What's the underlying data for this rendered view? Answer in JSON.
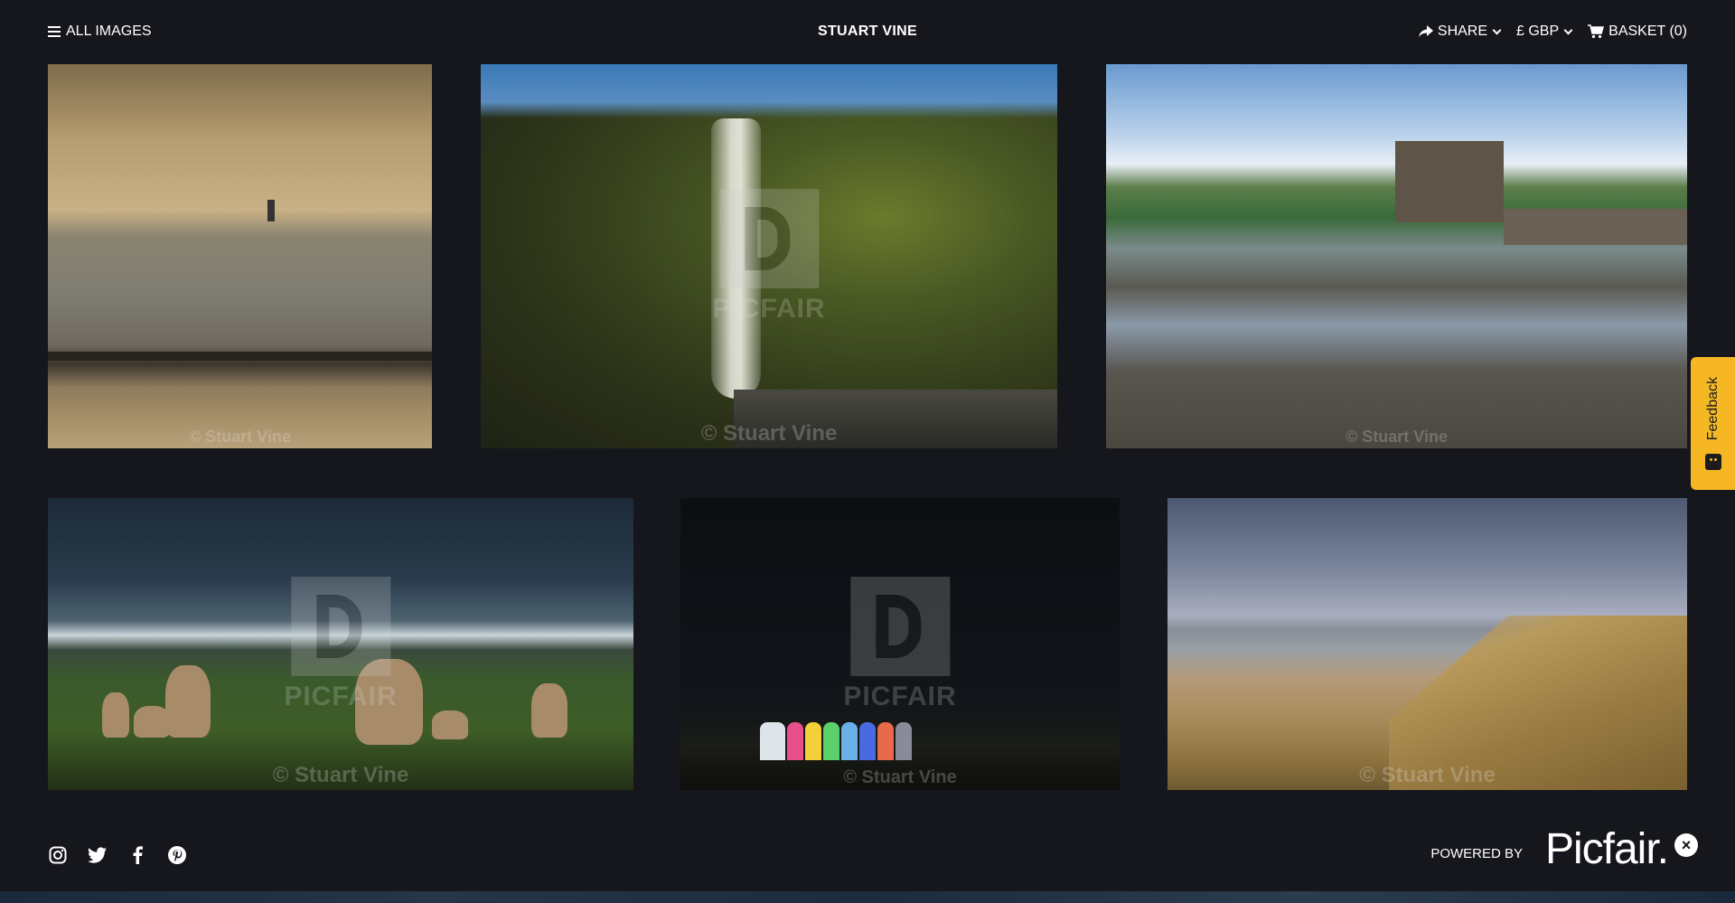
{
  "header": {
    "all_images_label": "ALL IMAGES",
    "title": "STUART VINE",
    "share_label": "SHARE",
    "currency_label": "£ GBP",
    "basket_label": "BASKET (0)"
  },
  "gallery": {
    "watermark_brand": "PICFAIR",
    "images": [
      {
        "copyright": "© Stuart Vine"
      },
      {
        "copyright": "© Stuart Vine"
      },
      {
        "copyright": "© Stuart Vine"
      },
      {
        "copyright": "© Stuart Vine"
      },
      {
        "copyright": "© Stuart Vine"
      },
      {
        "copyright": "© Stuart Vine"
      }
    ]
  },
  "feedback": {
    "label": "Feedback"
  },
  "footer": {
    "social": [
      "instagram-icon",
      "twitter-icon",
      "facebook-icon",
      "pinterest-icon"
    ],
    "powered_by": "POWERED BY",
    "brand": "Picfair.",
    "close_symbol": "×"
  },
  "colors": {
    "background": "#16171d",
    "feedback_tab": "#f5b724",
    "text": "#ffffff"
  }
}
